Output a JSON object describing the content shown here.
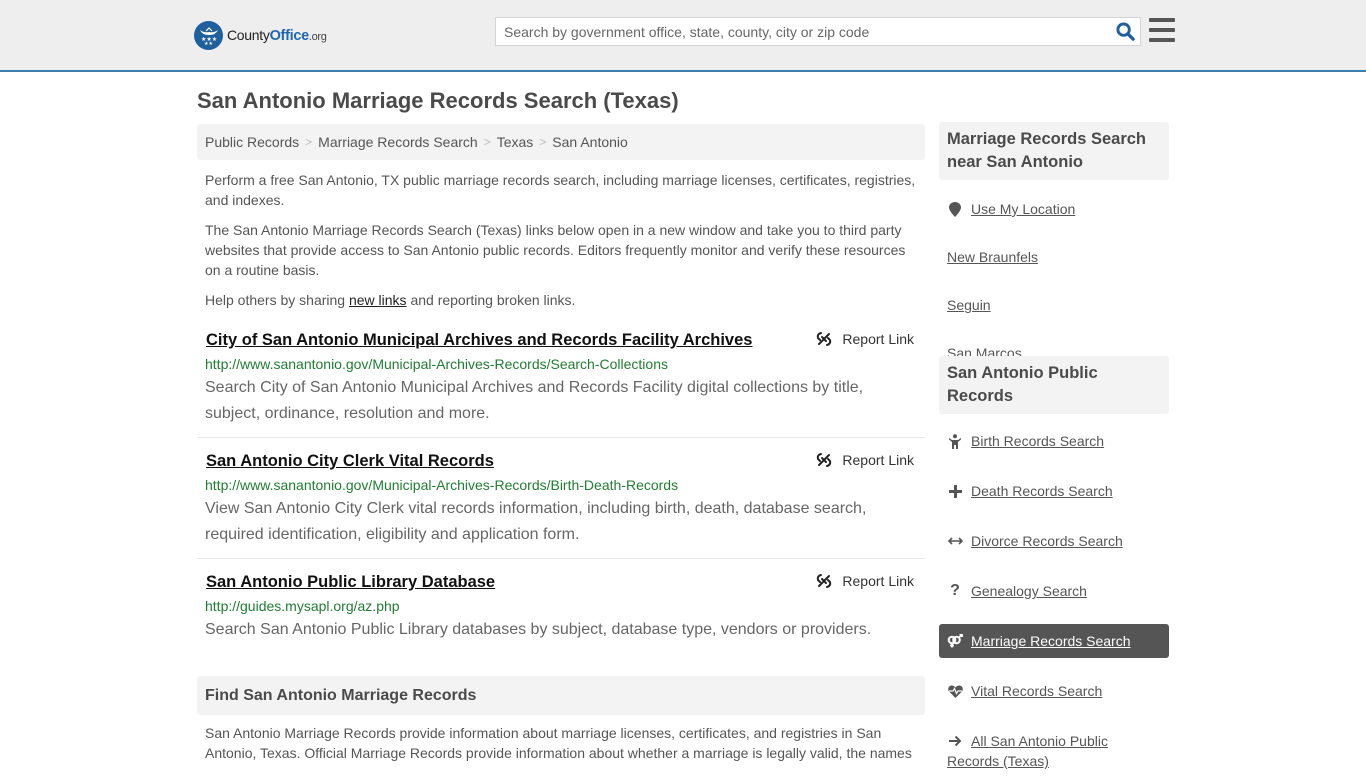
{
  "header": {
    "logo": {
      "name": "County",
      "name_bold": "Office",
      "tld": ".org"
    },
    "search": {
      "placeholder": "Search by government office, state, county, city or zip code",
      "value": ""
    },
    "icons": {
      "search": "search-icon",
      "menu": "hamburger-menu-icon"
    }
  },
  "page": {
    "title": "San Antonio Marriage Records Search (Texas)"
  },
  "breadcrumb": [
    {
      "label": "Public Records"
    },
    {
      "label": "Marriage Records Search"
    },
    {
      "label": "Texas"
    },
    {
      "label": "San Antonio"
    }
  ],
  "breadcrumb_separator": ">",
  "intro": {
    "p1": "Perform a free San Antonio, TX public marriage records search, including marriage licenses, certificates, registries, and indexes.",
    "p2": "The San Antonio Marriage Records Search (Texas) links below open in a new window and take you to third party websites that provide access to San Antonio public records. Editors frequently monitor and verify these resources on a routine basis.",
    "p3_before": "Help others by sharing ",
    "p3_link": "new links",
    "p3_after": " and reporting broken links."
  },
  "results": [
    {
      "title": "City of San Antonio Municipal Archives and Records Facility Archives",
      "url": "http://www.sanantonio.gov/Municipal-Archives-Records/Search-Collections",
      "description": "Search City of San Antonio Municipal Archives and Records Facility digital collections by title, subject, ordinance, resolution and more.",
      "report_label": "Report Link"
    },
    {
      "title": "San Antonio City Clerk Vital Records",
      "url": "http://www.sanantonio.gov/Municipal-Archives-Records/Birth-Death-Records",
      "description": "View San Antonio City Clerk vital records information, including birth, death, database search, required identification, eligibility and application form.",
      "report_label": "Report Link"
    },
    {
      "title": "San Antonio Public Library Database",
      "url": "http://guides.mysapl.org/az.php",
      "description": "Search San Antonio Public Library databases by subject, database type, vendors or providers.",
      "report_label": "Report Link"
    }
  ],
  "find_section": {
    "title": "Find San Antonio Marriage Records",
    "body": "San Antonio Marriage Records provide information about marriage licenses, certificates, and registries in San Antonio, Texas. Official Marriage Records provide information about whether a marriage is legally valid, the names"
  },
  "sidebar": {
    "nearby": {
      "title": "Marriage Records Search near San Antonio",
      "use_location": "Use My Location",
      "items": [
        {
          "label": "New Braunfels"
        },
        {
          "label": "Seguin"
        },
        {
          "label": "San Marcos"
        }
      ]
    },
    "public_records": {
      "title": "San Antonio Public Records",
      "items": [
        {
          "label": "Birth Records Search",
          "icon": "child-icon",
          "active": false
        },
        {
          "label": "Death Records Search",
          "icon": "cross-icon",
          "active": false
        },
        {
          "label": "Divorce Records Search",
          "icon": "arrows-horizontal-icon",
          "active": false
        },
        {
          "label": "Genealogy Search",
          "icon": "question-icon",
          "active": false
        },
        {
          "label": "Marriage Records Search",
          "icon": "venus-mars-icon",
          "active": true
        },
        {
          "label": "Vital Records Search",
          "icon": "heartbeat-icon",
          "active": false
        },
        {
          "label": "All San Antonio Public Records (Texas)",
          "icon": "arrow-right-icon",
          "active": false
        }
      ]
    }
  },
  "colors": {
    "accent_blue": "#3a7fb0",
    "logo_blue": "#1d66b1",
    "url_green": "#217d32",
    "active_bg": "#555555"
  }
}
